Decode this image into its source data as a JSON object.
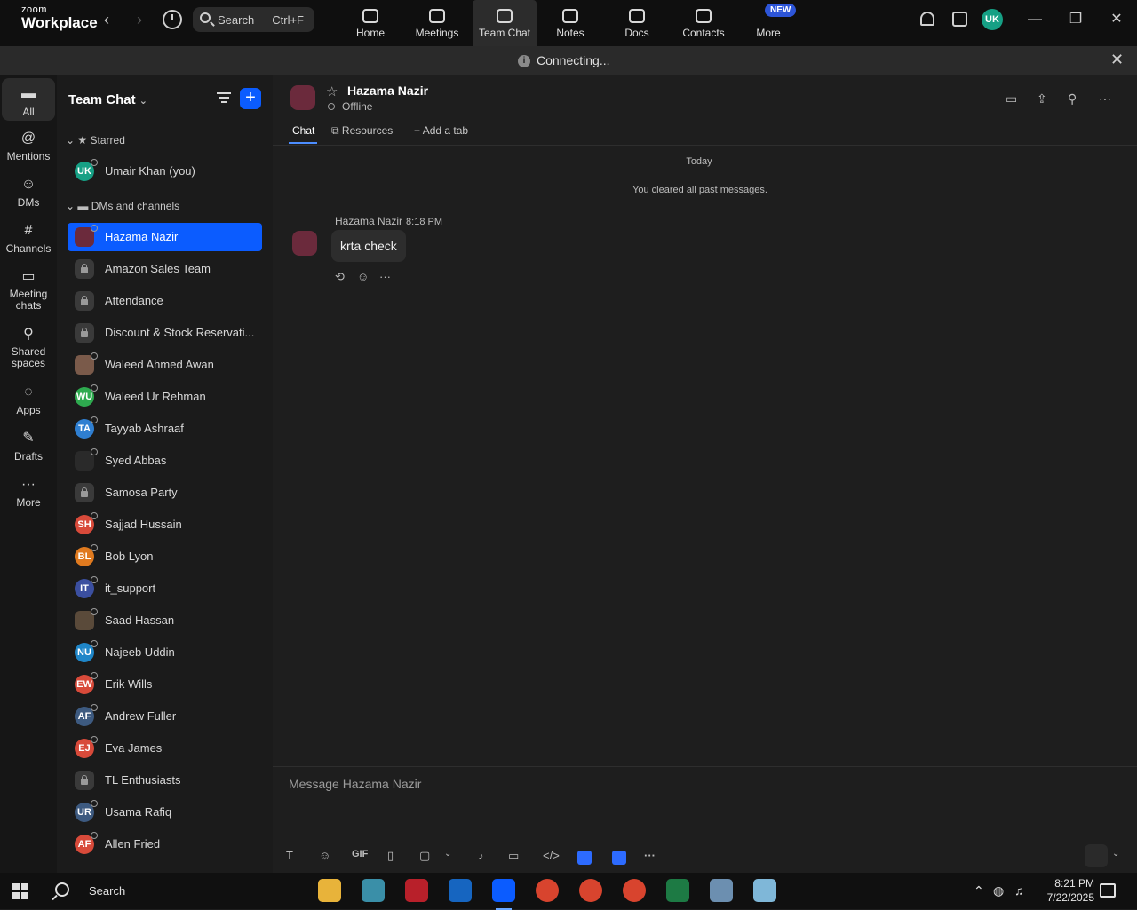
{
  "app": {
    "logo_top": "zoom",
    "logo_bottom": "Workplace"
  },
  "topbar": {
    "search_label": "Search",
    "search_shortcut": "Ctrl+F",
    "nav": [
      "Home",
      "Meetings",
      "Team Chat",
      "Notes",
      "Docs",
      "Contacts",
      "More"
    ],
    "new_badge": "NEW",
    "avatar_initials": "UK"
  },
  "connection_bar": {
    "text": "Connecting..."
  },
  "rail": [
    {
      "label": "All",
      "icon": "chat-bubble-icon"
    },
    {
      "label": "Mentions",
      "icon": "at-icon"
    },
    {
      "label": "DMs",
      "icon": "people-icon"
    },
    {
      "label": "Channels",
      "icon": "hash-icon"
    },
    {
      "label": "Meeting chats",
      "icon": "calendar-chat-icon"
    },
    {
      "label": "Shared spaces",
      "icon": "share-icon"
    },
    {
      "label": "Apps",
      "icon": "apps-icon"
    },
    {
      "label": "Drafts",
      "icon": "drafts-icon"
    },
    {
      "label": "More",
      "icon": "ellipsis-icon"
    }
  ],
  "sidebar": {
    "title": "Team Chat",
    "starred_label": "Starred",
    "starred": [
      {
        "name": "Umair Khan (you)",
        "initials": "UK",
        "color": "#16a085"
      }
    ],
    "dms_label": "DMs and channels",
    "items": [
      {
        "name": "Hazama Nazir",
        "initials": "",
        "color": "#6b2a3c",
        "selected": true
      },
      {
        "name": "Amazon Sales Team",
        "initials": "",
        "color": "",
        "locked": true
      },
      {
        "name": "Attendance",
        "initials": "",
        "color": "",
        "locked": true
      },
      {
        "name": "Discount & Stock Reservati...",
        "initials": "",
        "color": "",
        "locked": true
      },
      {
        "name": "Waleed Ahmed Awan",
        "initials": "",
        "color": "#7a5a4a"
      },
      {
        "name": "Waleed Ur Rehman",
        "initials": "WU",
        "color": "#2eaa4f"
      },
      {
        "name": "Tayyab Ashraaf",
        "initials": "TA",
        "color": "#2f7fd1"
      },
      {
        "name": "Syed Abbas",
        "initials": "",
        "color": "#2a2a2a"
      },
      {
        "name": "Samosa Party",
        "initials": "",
        "color": "",
        "locked": true
      },
      {
        "name": "Sajjad Hussain",
        "initials": "SH",
        "color": "#d84a3a"
      },
      {
        "name": "Bob Lyon",
        "initials": "BL",
        "color": "#e07a1f"
      },
      {
        "name": "it_support",
        "initials": "IT",
        "color": "#3b4fa0"
      },
      {
        "name": "Saad Hassan",
        "initials": "",
        "color": "#5a4a3a"
      },
      {
        "name": "Najeeb Uddin",
        "initials": "NU",
        "color": "#1f86c8"
      },
      {
        "name": "Erik Wills",
        "initials": "EW",
        "color": "#d84a3a"
      },
      {
        "name": "Andrew Fuller",
        "initials": "AF",
        "color": "#3d5a80"
      },
      {
        "name": "Eva James",
        "initials": "EJ",
        "color": "#d84a3a"
      },
      {
        "name": "TL Enthusiasts",
        "initials": "",
        "color": "",
        "locked": true
      },
      {
        "name": "Usama Rafiq",
        "initials": "UR",
        "color": "#3d5a80"
      },
      {
        "name": "Allen Fried",
        "initials": "AF",
        "color": "#d84a3a"
      }
    ]
  },
  "chat": {
    "contact_name": "Hazama Nazir",
    "contact_status": "Offline",
    "tabs": [
      "Chat",
      "Resources",
      "Add a tab"
    ],
    "date_separator": "Today",
    "system_note": "You cleared all past messages.",
    "message": {
      "sender": "Hazama Nazir",
      "time": "8:18 PM",
      "text": "krta check"
    },
    "composer_placeholder": "Message Hazama Nazir",
    "gif_label": "GIF"
  },
  "taskbar": {
    "search_label": "Search",
    "time": "8:21 PM",
    "date": "7/22/2025"
  },
  "colors": {
    "accent": "#0b5cff",
    "background": "#1e1e1e",
    "sidebar": "#1b1b1b"
  }
}
